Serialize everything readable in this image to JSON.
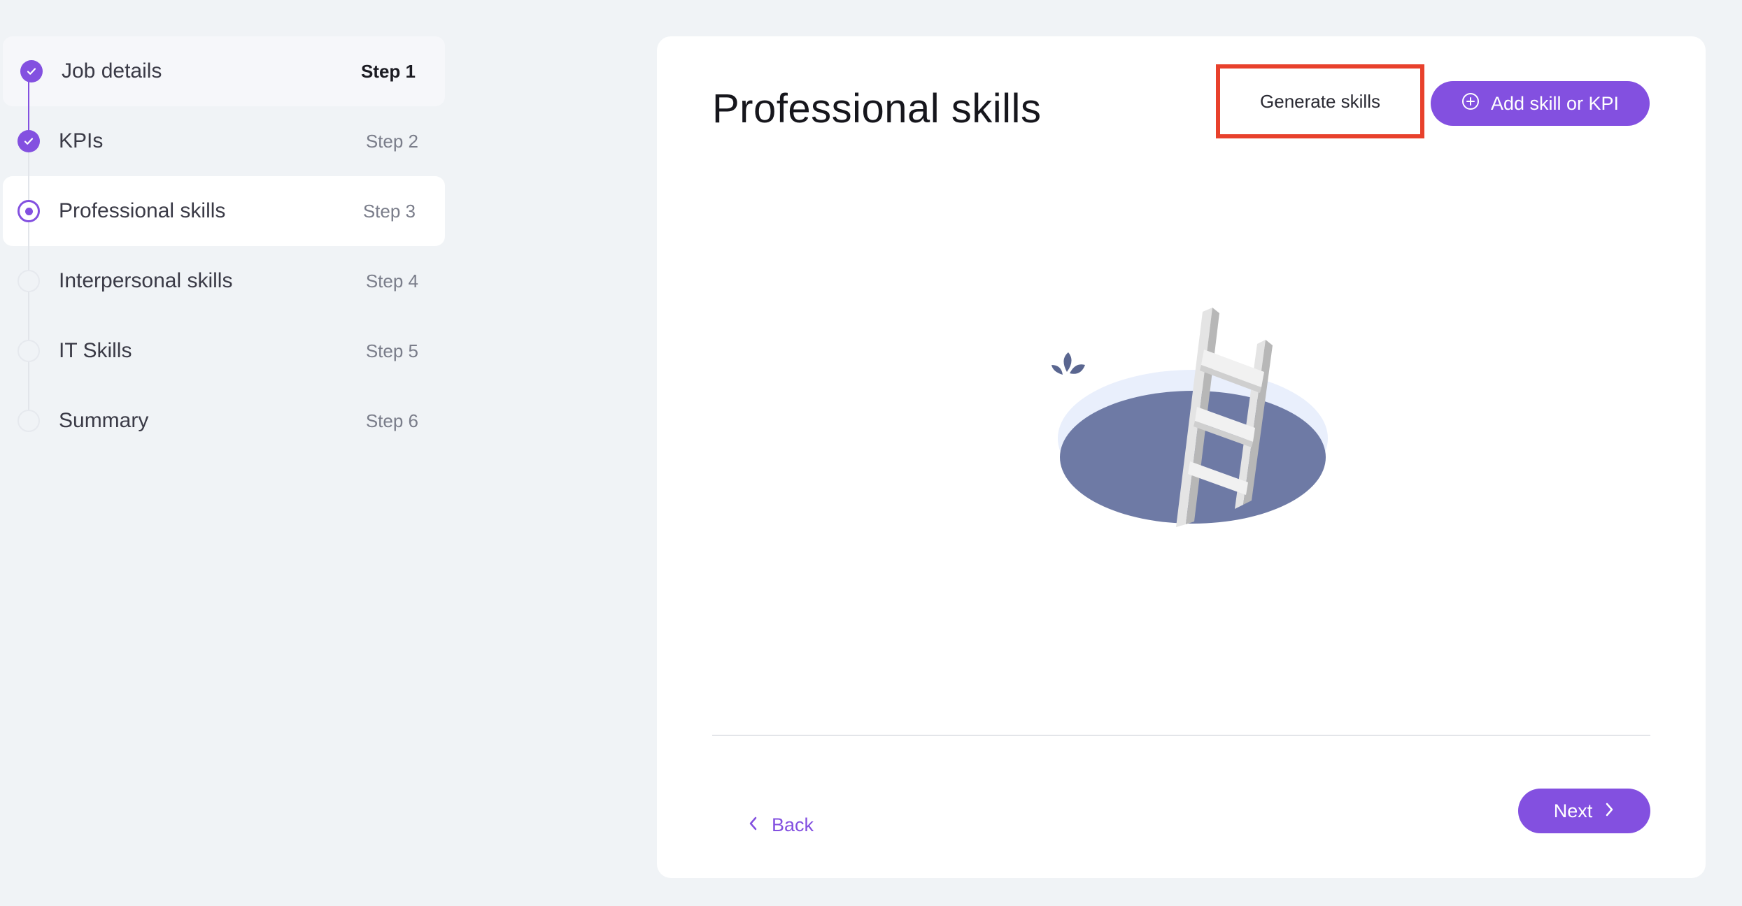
{
  "stepper": {
    "steps": [
      {
        "label": "Job details",
        "step": "Step 1",
        "state": "done"
      },
      {
        "label": "KPIs",
        "step": "Step 2",
        "state": "done"
      },
      {
        "label": "Professional skills",
        "step": "Step 3",
        "state": "current"
      },
      {
        "label": "Interpersonal skills",
        "step": "Step 4",
        "state": "todo"
      },
      {
        "label": "IT Skills",
        "step": "Step 5",
        "state": "todo"
      },
      {
        "label": "Summary",
        "step": "Step 6",
        "state": "todo"
      }
    ]
  },
  "main": {
    "title": "Professional skills",
    "generate_label": "Generate skills",
    "add_label": "Add skill or KPI",
    "empty_illustration": "ladder-in-hole-illustration"
  },
  "footer": {
    "back_label": "Back",
    "next_label": "Next"
  },
  "colors": {
    "accent": "#8350e0",
    "highlight": "#e8412c",
    "background": "#f0f3f6"
  }
}
